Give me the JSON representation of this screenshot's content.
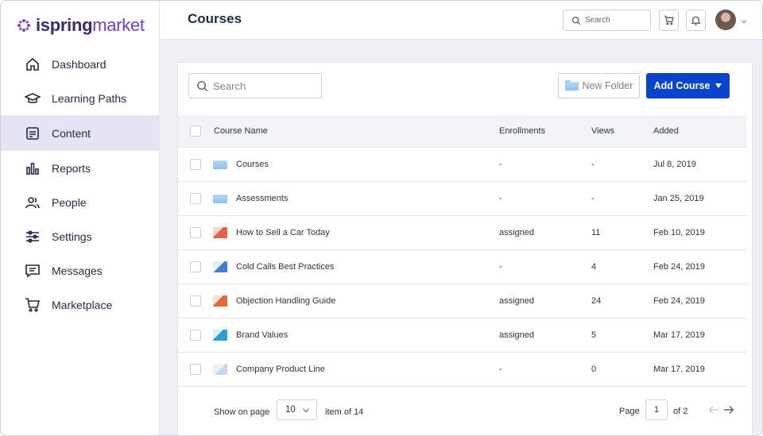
{
  "brand": {
    "logo_text_1": "ispring",
    "logo_text_2": "market"
  },
  "sidebar": {
    "items": [
      {
        "label": "Dashboard"
      },
      {
        "label": "Learning Paths"
      },
      {
        "label": "Content"
      },
      {
        "label": "Reports"
      },
      {
        "label": "People"
      },
      {
        "label": "Settings"
      },
      {
        "label": "Messages"
      },
      {
        "label": "Marketplace"
      }
    ]
  },
  "header": {
    "title": "Courses",
    "search_placeholder": "Search"
  },
  "toolbar": {
    "search_placeholder": "Search",
    "new_folder_label": "New Folder",
    "add_course_label": "Add Course"
  },
  "table": {
    "columns": [
      "Course Name",
      "Enrollments",
      "Views",
      "Added"
    ],
    "rows": [
      {
        "name": "Courses",
        "enrollments": "-",
        "views": "-",
        "added": "Jul 8, 2019",
        "kind": "folder"
      },
      {
        "name": "Assessments",
        "enrollments": "-",
        "views": "-",
        "added": "Jan 25, 2019",
        "kind": "folder"
      },
      {
        "name": "How to Sell a Car Today",
        "enrollments": "assigned",
        "views": "11",
        "added": "Feb 10, 2019",
        "kind": "course-red"
      },
      {
        "name": "Cold Calls Best Practices",
        "enrollments": "-",
        "views": "4",
        "added": "Feb 24, 2019",
        "kind": "course-blue"
      },
      {
        "name": "Objection Handling Guide",
        "enrollments": "assigned",
        "views": "24",
        "added": "Feb 24, 2019",
        "kind": "course-orange"
      },
      {
        "name": "Brand Values",
        "enrollments": "assigned",
        "views": "5",
        "added": "Mar 17, 2019",
        "kind": "course-teal"
      },
      {
        "name": "Company Product Line",
        "enrollments": "-",
        "views": "0",
        "added": "Mar 17, 2019",
        "kind": "course-light"
      }
    ]
  },
  "pagination": {
    "show_label": "Show on page",
    "per_page": "10",
    "items_text": "item of 14",
    "page_label": "Page",
    "current_page": "1",
    "of_label": "of 2"
  },
  "colors": {
    "accent": "#0a44cc",
    "brand": "#5b2fb3",
    "active_nav_bg": "#e4e4f4"
  }
}
